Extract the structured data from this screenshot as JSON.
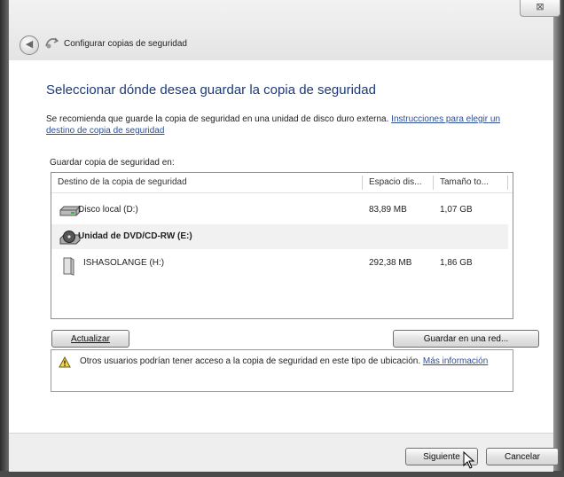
{
  "window": {
    "title": "Configurar copias de seguridad",
    "close_glyph": "⊠"
  },
  "icons": {
    "back": "back-arrow-icon",
    "wizard": "backup-wizard-icon",
    "warning": "warning-icon",
    "drive": "hard-drive-icon",
    "dvd": "dvd-drive-icon",
    "usb": "usb-drive-icon"
  },
  "main": {
    "heading": "Seleccionar dónde desea guardar la copia de seguridad",
    "description": "Se recomienda que guarde la copia de seguridad en una unidad de disco duro externa.",
    "description_link": "Instrucciones para elegir un destino de copia de seguridad",
    "save_label": "Guardar copia de seguridad en:"
  },
  "table": {
    "columns": [
      "Destino de la copia de seguridad",
      "Espacio dis...",
      "Tamaño to..."
    ],
    "rows": [
      {
        "destination": "Disco local (D:)",
        "free": "83,89 MB",
        "total": "1,07 GB"
      },
      {
        "destination": "Unidad de DVD/CD-RW (E:)",
        "free": "",
        "total": ""
      },
      {
        "destination": "ISHASOLANGE (H:)",
        "free": "292,38 MB",
        "total": "1,86 GB"
      }
    ]
  },
  "buttons": {
    "refresh": "Actualizar",
    "save_network": "Guardar en una red...",
    "next": "Siguiente",
    "cancel": "Cancelar"
  },
  "info": {
    "text": "Otros usuarios podrían tener acceso a la copia de seguridad en este tipo de ubicación.",
    "link": "Más información"
  }
}
